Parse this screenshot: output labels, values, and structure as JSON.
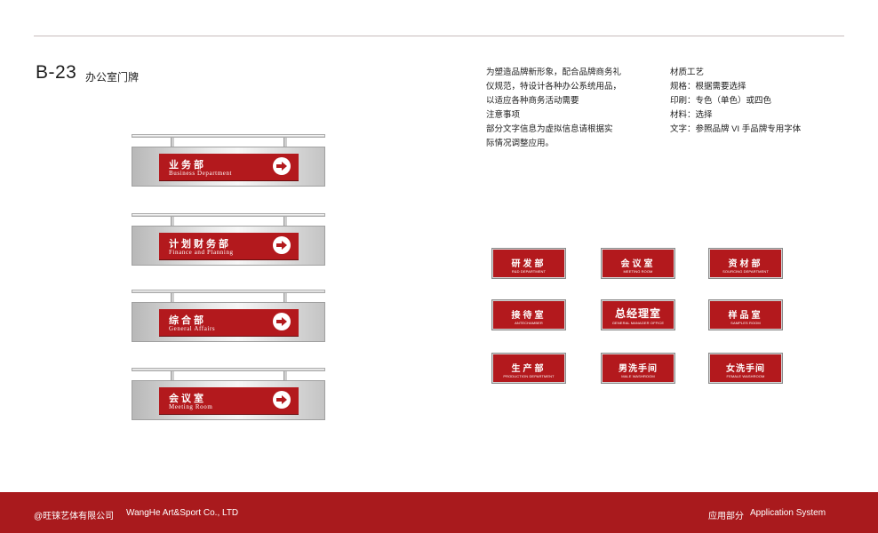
{
  "header": {
    "code": "B-23",
    "title": "办公室门牌"
  },
  "description": [
    "为塑造品牌新形象，配合品牌商务礼",
    "仪规范，特设计各种办公系统用品，",
    "以适应各种商务活动需要",
    "注意事项",
    "部分文字信息为虚拟信息请根据实",
    "际情况调整应用。"
  ],
  "specs": [
    "材质工艺",
    "规格：根据需要选择",
    "印刷：专色（单色）或四色",
    "材料：选择",
    "文字：参照品牌 VI 手品牌专用字体"
  ],
  "hanging_signs": [
    {
      "cn": "业务部",
      "en": "Business Department"
    },
    {
      "cn": "计划财务部",
      "en": "Finance and Planning"
    },
    {
      "cn": "综合部",
      "en": "General Affairs"
    },
    {
      "cn": "会议室",
      "en": "Meeting Room"
    }
  ],
  "door_plates": [
    {
      "cn": "研发部",
      "en": "R&D DEPARTMENT"
    },
    {
      "cn": "会议室",
      "en": "MEETING ROOM"
    },
    {
      "cn": "资材部",
      "en": "SOURCING DEPARTMENT"
    },
    {
      "cn": "接待室",
      "en": "ANTECHAMBER"
    },
    {
      "cn": "总经理室",
      "en": "GENERAL MANAGER OFFICE"
    },
    {
      "cn": "样品室",
      "en": "SAMPLES ROOM"
    },
    {
      "cn": "生产部",
      "en": "PRODUCTION DEPARTMENT"
    },
    {
      "cn": "男洗手间",
      "en": "MALE WASHROOM"
    },
    {
      "cn": "女洗手间",
      "en": "FEMALE WASHROOM"
    }
  ],
  "footer": {
    "company_cn": "@旺铼艺体有限公司",
    "company_en": "WangHe Art&Sport Co., LTD",
    "section_cn": "应用部分",
    "section_en": "Application System"
  },
  "colors": {
    "brand_red": "#b3191d",
    "footer_red": "#a91a1d",
    "arrow_icon": "circle-arrow-right-icon"
  }
}
